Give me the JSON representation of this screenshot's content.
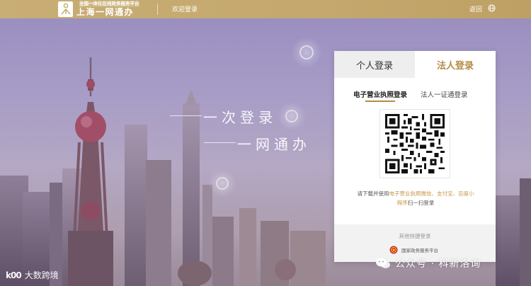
{
  "header": {
    "logo_subtitle": "全国一体化在线政务服务平台",
    "logo_title": "上海一网通办",
    "welcome": "欢迎登录",
    "back": "返回",
    "language_icon": "globe-icon"
  },
  "hero": {
    "slogan_line1": "一次登录",
    "slogan_line2": "一网通办"
  },
  "login": {
    "tab_personal": "个人登录",
    "tab_legal": "法人登录",
    "subtab_ebiz": "电子营业执照登录",
    "subtab_legal_cert": "法人一证通登录",
    "instruction_pre": "请下载并使用",
    "instruction_hl1": "电子营业执照微信、支付宝、百度小程序",
    "instruction_post": "扫一扫登录",
    "quick_login_title": "其他快捷登录",
    "national_platform": "国家政务服务平台"
  },
  "watermarks": {
    "left_logo": "k00",
    "left_text": "大数跨境",
    "right_text": "公众号 · 科新洛询"
  },
  "colors": {
    "topbar": "#c6aa6e",
    "accent": "#b58b45",
    "highlight": "#c69646"
  }
}
